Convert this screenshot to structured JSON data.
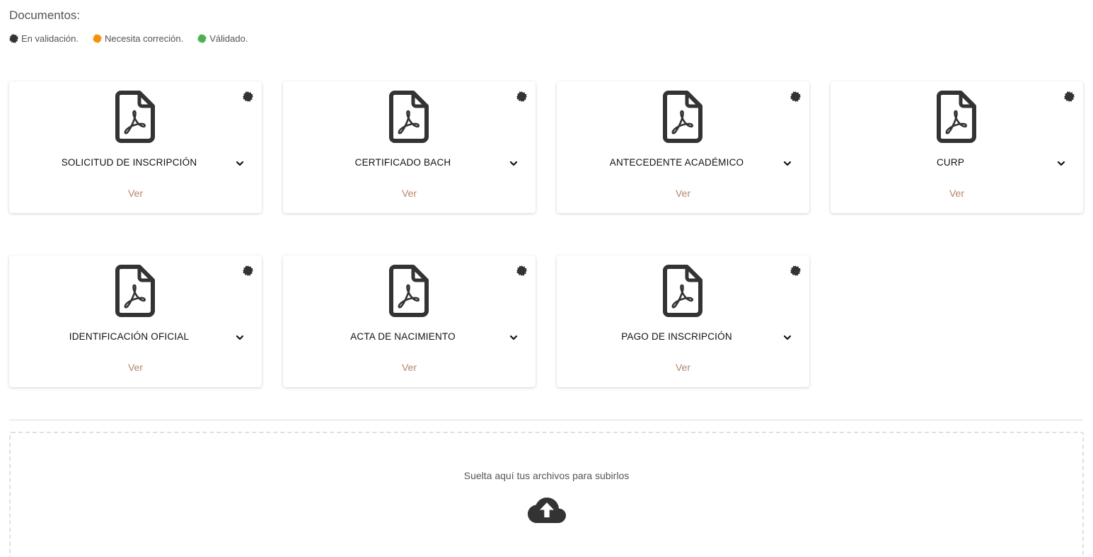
{
  "heading": "Documentos:",
  "legend": [
    {
      "label": "En validación.",
      "color": "#333333"
    },
    {
      "label": "Necesita correción.",
      "color": "#f5900f"
    },
    {
      "label": "Válidado.",
      "color": "#4caf50"
    }
  ],
  "documents": [
    {
      "title": "SOLICITUD DE INSCRIPCIÓN",
      "view": "Ver",
      "status_color": "#333333"
    },
    {
      "title": "CERTIFICADO BACH",
      "view": "Ver",
      "status_color": "#333333"
    },
    {
      "title": "ANTECEDENTE ACADÉMICO",
      "view": "Ver",
      "status_color": "#333333"
    },
    {
      "title": "CURP",
      "view": "Ver",
      "status_color": "#333333"
    },
    {
      "title": "IDENTIFICACIÓN OFICIAL",
      "view": "Ver",
      "status_color": "#333333"
    },
    {
      "title": "ACTA DE NACIMIENTO",
      "view": "Ver",
      "status_color": "#333333"
    },
    {
      "title": "PAGO DE INSCRIPCIÓN",
      "view": "Ver",
      "status_color": "#333333"
    }
  ],
  "icons": {
    "document": "file-pdf-icon",
    "expand": "chevron-down-icon",
    "status": "status-badge-icon",
    "upload": "cloud-upload-icon"
  },
  "dropzone": {
    "text": "Suelta aquí tus archivos para subirlos"
  },
  "colors": {
    "link": "#b5856a",
    "icon": "#333333"
  }
}
